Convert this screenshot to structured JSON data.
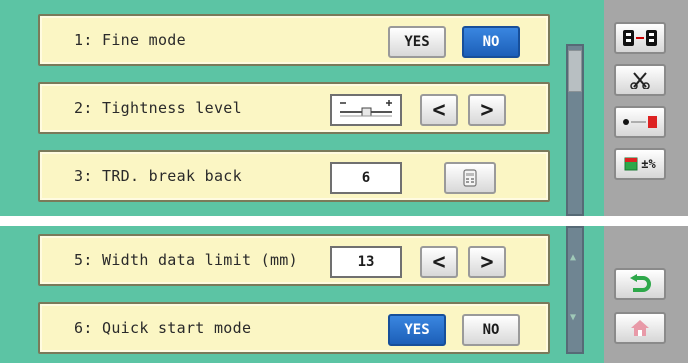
{
  "settings": {
    "fine_mode": {
      "label": "1: Fine mode",
      "yes_label": "YES",
      "no_label": "NO",
      "selected": "NO"
    },
    "tightness": {
      "label": "2: Tightness level",
      "prev": "<",
      "next": ">"
    },
    "trd_break_back": {
      "label": "3: TRD. break back",
      "value": "6"
    },
    "width_limit": {
      "label": "5: Width data limit (mm)",
      "value": "13",
      "prev": "<",
      "next": ">"
    },
    "quick_start": {
      "label": "6: Quick start mode",
      "yes_label": "YES",
      "no_label": "NO",
      "selected": "YES"
    }
  },
  "sidebar": {
    "percent_text": "±%",
    "colors": {
      "active_blue": "#1c5fb8",
      "panel_green": "#5cc4a4",
      "row_yellow": "#fbf6c4"
    }
  }
}
